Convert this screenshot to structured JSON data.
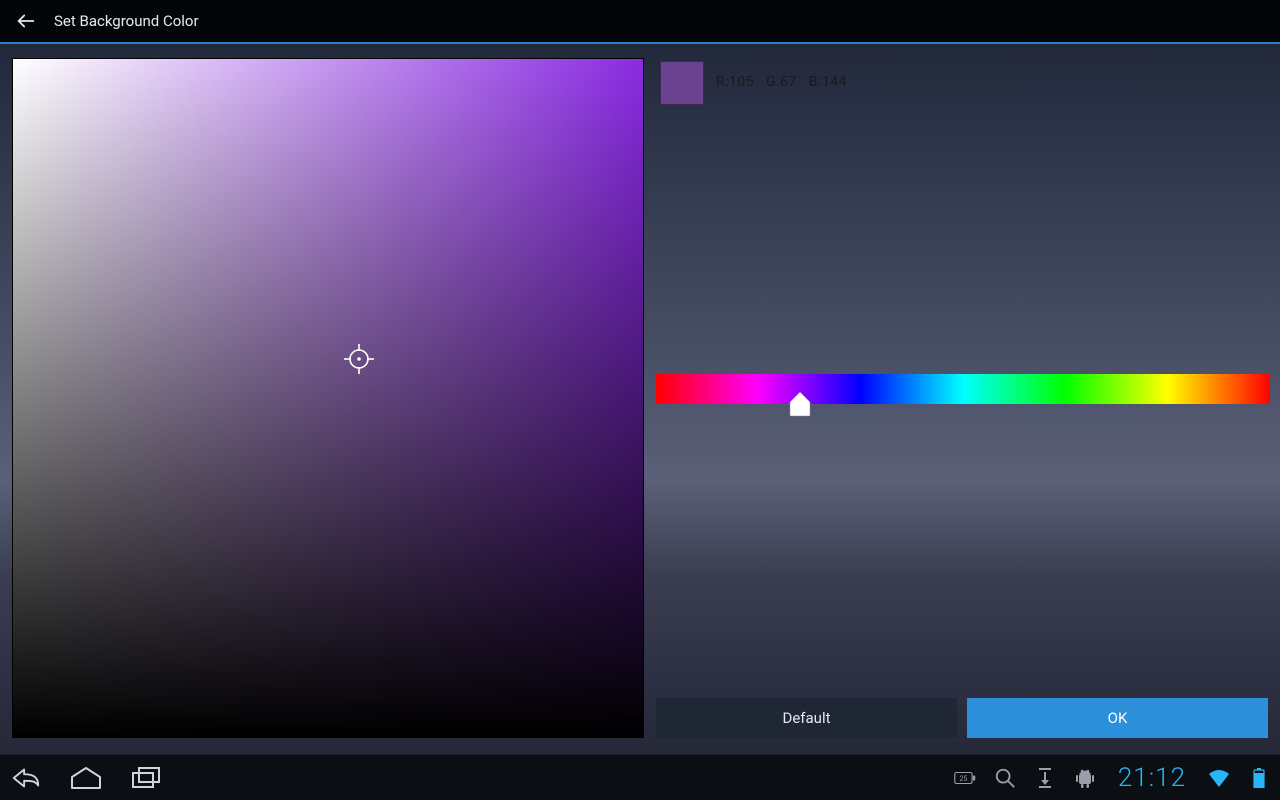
{
  "header": {
    "title": "Set Background Color"
  },
  "color": {
    "swatch_hex": "#694390",
    "r_label": "R:105",
    "g_label": "G:67",
    "b_label": "B:144"
  },
  "buttons": {
    "default_label": "Default",
    "ok_label": "OK"
  },
  "statusbar": {
    "battery_pct": "25",
    "clock": "21:12"
  },
  "icons": {
    "back": "back-arrow-icon",
    "nav_back": "nav-back-icon",
    "nav_home": "nav-home-icon",
    "nav_recent": "nav-recent-icon",
    "search": "search-icon",
    "sync": "sync-icon",
    "android": "android-icon",
    "wifi": "wifi-icon",
    "battery": "battery-icon"
  }
}
